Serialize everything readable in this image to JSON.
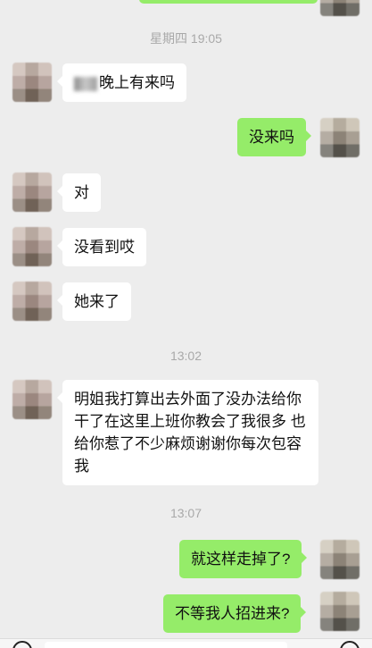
{
  "timestamps": [
    "星期四 19:05",
    "13:02",
    "13:07"
  ],
  "messages": [
    {
      "side": "left",
      "text": "晚上有来吗",
      "partially_obscured": true
    },
    {
      "side": "right",
      "text": "没来吗"
    },
    {
      "side": "left",
      "text": "对"
    },
    {
      "side": "left",
      "text": "没看到哎"
    },
    {
      "side": "left",
      "text": "她来了"
    },
    {
      "side": "left",
      "text": "明姐我打算出去外面了没办法给你干了在这里上班你教会了我很多 也给你惹了不少麻烦谢谢你每次包容我"
    },
    {
      "side": "right",
      "text": "就这样走掉了?"
    },
    {
      "side": "right",
      "text": "不等我人招进来?"
    }
  ],
  "icons": {
    "voice": "voice-circle-icon",
    "add": "plus-circle-icon"
  },
  "colors": {
    "background": "#ededed",
    "bubble_in": "#ffffff",
    "bubble_out": "#95ec69",
    "timestamp": "#a9a9a9"
  }
}
